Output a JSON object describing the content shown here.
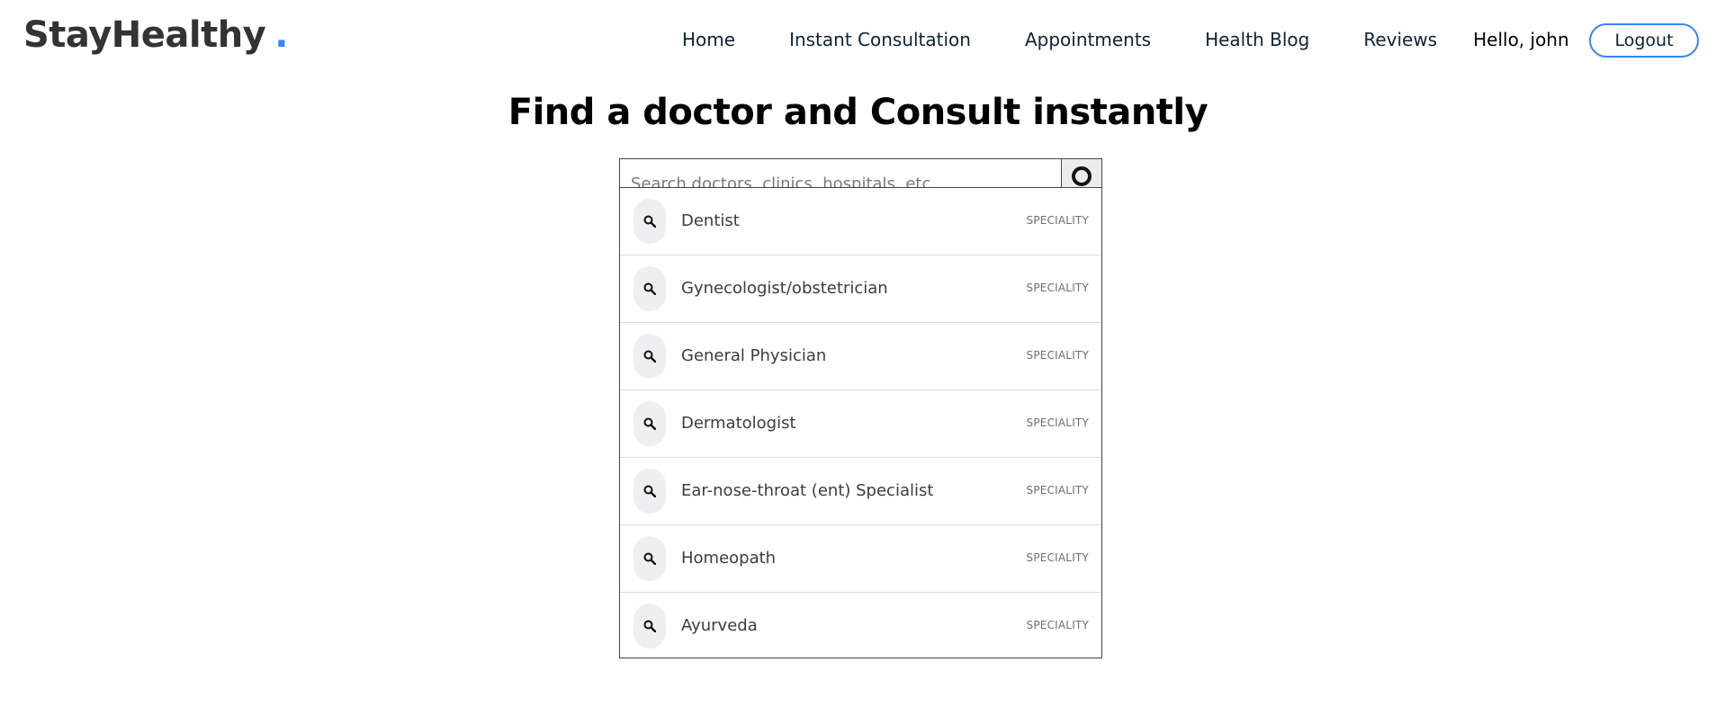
{
  "brand": {
    "name": "StayHealthy",
    "dot": ".",
    "accent_color": "#3685fb"
  },
  "nav": {
    "links": [
      {
        "label": "Home"
      },
      {
        "label": "Instant Consultation"
      },
      {
        "label": "Appointments"
      },
      {
        "label": "Health Blog"
      },
      {
        "label": "Reviews"
      }
    ],
    "greeting": "Hello, john",
    "logout_label": "Logout"
  },
  "main": {
    "heading": "Find a doctor and Consult instantly",
    "search": {
      "placeholder": "Search doctors, clinics, hospitals, etc.",
      "value": "",
      "button_icon": "search-icon"
    },
    "suggestions": [
      {
        "label": "Dentist",
        "tag": "SPECIALITY",
        "icon": "search-icon"
      },
      {
        "label": "Gynecologist/obstetrician",
        "tag": "SPECIALITY",
        "icon": "search-icon"
      },
      {
        "label": "General Physician",
        "tag": "SPECIALITY",
        "icon": "search-icon"
      },
      {
        "label": "Dermatologist",
        "tag": "SPECIALITY",
        "icon": "search-icon"
      },
      {
        "label": "Ear-nose-throat (ent) Specialist",
        "tag": "SPECIALITY",
        "icon": "search-icon"
      },
      {
        "label": "Homeopath",
        "tag": "SPECIALITY",
        "icon": "search-icon"
      },
      {
        "label": "Ayurveda",
        "tag": "SPECIALITY",
        "icon": "search-icon"
      }
    ]
  }
}
